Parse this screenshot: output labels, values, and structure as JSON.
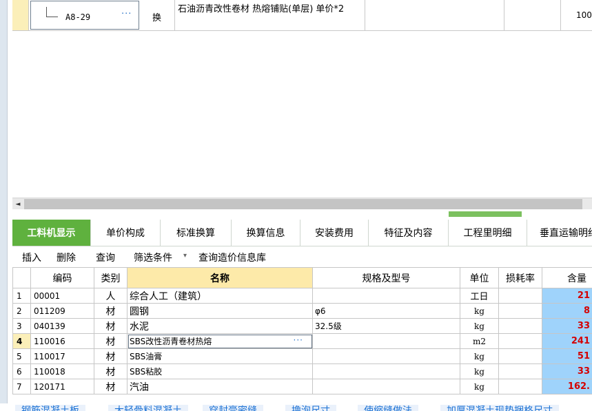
{
  "top_row": {
    "code": "A8-29",
    "code_dots": "···",
    "type": "换",
    "name": "石油沥青改性卷材 热熔铺贴(单层)  单价*2",
    "qty": "100"
  },
  "scrollbar": {
    "left_arrow": "◄"
  },
  "tabs": [
    "工料机显示",
    "单价构成",
    "标准换算",
    "换算信息",
    "安装费用",
    "特征及内容",
    "工程里明细",
    "垂直运输明细"
  ],
  "toolbar": {
    "insert": "插入",
    "delete": "删除",
    "query": "查询",
    "filter": "筛选条件",
    "filter_caret": "▾",
    "price_db": "查询造价信息库"
  },
  "grid": {
    "headers": [
      "",
      "编码",
      "类别",
      "名称",
      "规格及型号",
      "单位",
      "损耗率",
      "含量"
    ],
    "rows": [
      {
        "idx": "1",
        "code": "00001",
        "cat": "人",
        "name": "综合人工（建筑）",
        "spec": "",
        "unit": "工日",
        "loss": "",
        "qty": "21"
      },
      {
        "idx": "2",
        "code": "011209",
        "cat": "材",
        "name": "圆钢",
        "spec": "φ6",
        "unit": "kg",
        "loss": "",
        "qty": "8"
      },
      {
        "idx": "3",
        "code": "040139",
        "cat": "材",
        "name": "水泥",
        "spec": "32.5级",
        "unit": "kg",
        "loss": "",
        "qty": "33"
      },
      {
        "idx": "4",
        "code": "110016",
        "cat": "材",
        "name": "SBS改性沥青卷材热熔",
        "spec": "",
        "unit": "m2",
        "loss": "",
        "qty": "241"
      },
      {
        "idx": "5",
        "code": "110017",
        "cat": "材",
        "name": "SBS油膏",
        "spec": "",
        "unit": "kg",
        "loss": "",
        "qty": "51"
      },
      {
        "idx": "6",
        "code": "110018",
        "cat": "材",
        "name": "SBS粘胶",
        "spec": "",
        "unit": "kg",
        "loss": "",
        "qty": "33"
      },
      {
        "idx": "7",
        "code": "120171",
        "cat": "材",
        "name": "汽油",
        "spec": "",
        "unit": "kg",
        "loss": "",
        "qty": "162."
      }
    ],
    "selected_row_dots": "···"
  },
  "bottom_tags": [
    "钢筋混凝土板",
    "大轻骨料混凝土",
    "穿封膏密缝",
    "撸泡尺寸",
    "使缩缝做法",
    "加厚混凝土现垫捆格尺寸"
  ],
  "colors": {
    "tab_active": "#5fb13e",
    "header_name": "#fdeaa9",
    "qty_cell": "#9fd3fb",
    "qty_text": "#d40000",
    "selected_indicator": "#fbefb9"
  }
}
